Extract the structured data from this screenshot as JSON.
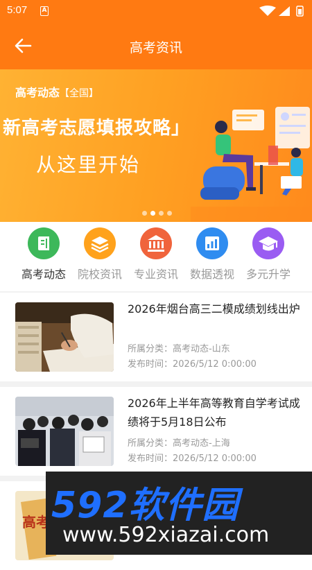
{
  "status": {
    "time": "5:07",
    "notif_icon": "a-app-icon"
  },
  "appbar": {
    "title": "高考资讯",
    "back_icon": "arrow-left-icon"
  },
  "banner": {
    "tag": "高考动态",
    "tag_region": "【全国】",
    "headline": "新高考志愿填报攻略」",
    "subline": "从这里开始",
    "slide_count": 4,
    "active_slide": 1
  },
  "categories": [
    {
      "label": "高考动态",
      "color": "#3db85a",
      "icon": "document-icon",
      "active": true
    },
    {
      "label": "院校资讯",
      "color": "#ffa21c",
      "icon": "book-stack-icon",
      "active": false
    },
    {
      "label": "专业资讯",
      "color": "#f0643c",
      "icon": "institution-icon",
      "active": false
    },
    {
      "label": "数据透视",
      "color": "#2f8cf0",
      "icon": "chart-icon",
      "active": false
    },
    {
      "label": "多元升学",
      "color": "#9a5cf2",
      "icon": "graduation-cap-icon",
      "active": false
    }
  ],
  "news": [
    {
      "title": "2026年烟台高三二模成绩划线出炉",
      "category": "所属分类：高考动态-山东",
      "time": "发布时间：2026/5/12 0:00:00"
    },
    {
      "title": "2026年上半年高等教育自学考试成绩将于5月18日公布",
      "category": "所属分类：高考动态-上海",
      "time": "发布时间：2026/5/12 0:00:00"
    },
    {
      "title": "",
      "category": "",
      "time": ""
    }
  ],
  "thumb_text": "高考",
  "watermark": {
    "brand": "592软件园",
    "url": "www.592xiazai.com"
  },
  "colors": {
    "primary": "#ff7a12",
    "text": "#222222",
    "muted": "#999999"
  }
}
